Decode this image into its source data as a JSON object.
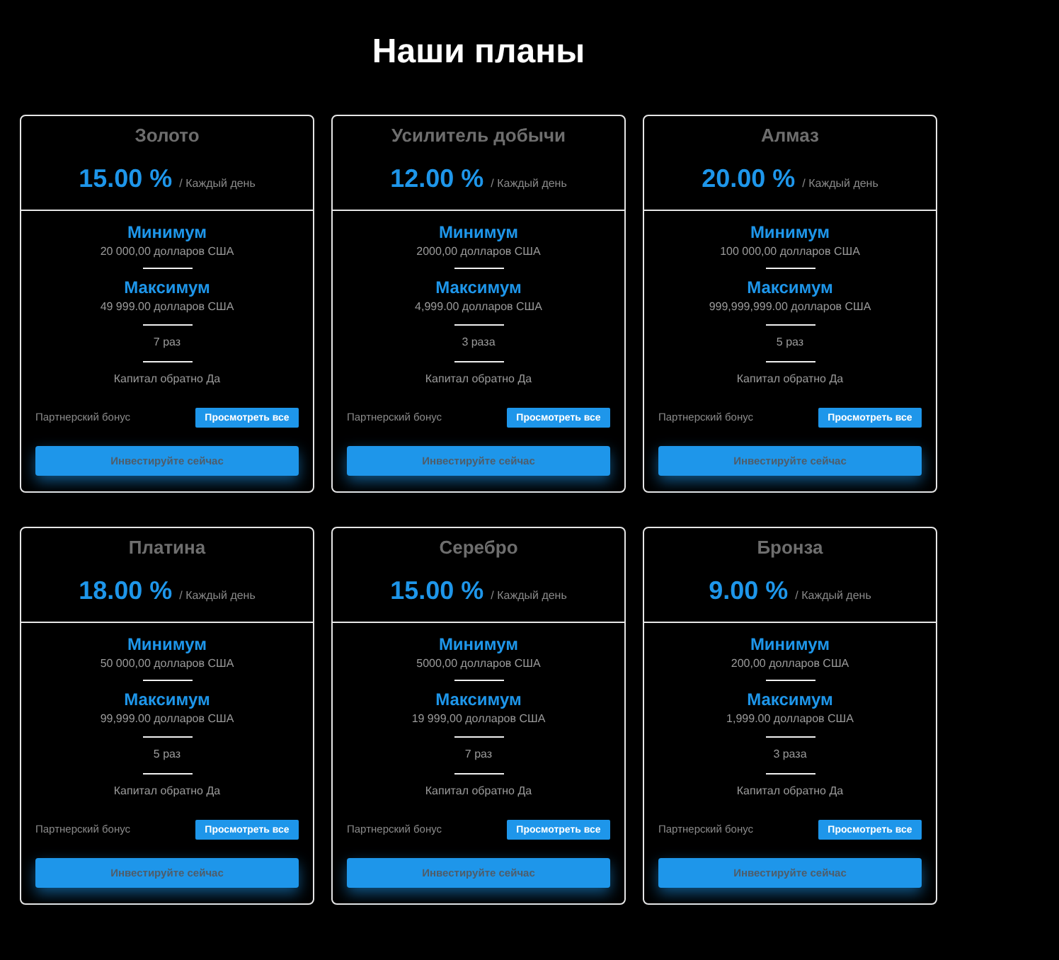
{
  "page": {
    "title": "Наши планы"
  },
  "plans": [
    {
      "name": "Золото",
      "rate": "15.00 %",
      "period": "/ Каждый день",
      "minimum_label": "Минимум",
      "minimum": "20 000,00 долларов США",
      "maximum_label": "Максимум",
      "maximum": "49 999.00 долларов США",
      "payouts": "7 раз",
      "capital_back": "Капитал обратно Да",
      "bonus_label": "Партнерский бонус",
      "bonus_button": "Просмотреть все",
      "invest_button": "Инвестируйте сейчас"
    },
    {
      "name": "Усилитель добычи",
      "rate": "12.00 %",
      "period": "/ Каждый день",
      "minimum_label": "Минимум",
      "minimum": "2000,00 долларов США",
      "maximum_label": "Максимум",
      "maximum": "4,999.00 долларов США",
      "payouts": "3 раза",
      "capital_back": "Капитал обратно Да",
      "bonus_label": "Партнерский бонус",
      "bonus_button": "Просмотреть все",
      "invest_button": "Инвестируйте сейчас"
    },
    {
      "name": "Алмаз",
      "rate": "20.00 %",
      "period": "/ Каждый день",
      "minimum_label": "Минимум",
      "minimum": "100 000,00 долларов США",
      "maximum_label": "Максимум",
      "maximum": "999,999,999.00 долларов США",
      "payouts": "5 раз",
      "capital_back": "Капитал обратно Да",
      "bonus_label": "Партнерский бонус",
      "bonus_button": "Просмотреть все",
      "invest_button": "Инвестируйте сейчас"
    },
    {
      "name": "Платина",
      "rate": "18.00 %",
      "period": "/ Каждый день",
      "minimum_label": "Минимум",
      "minimum": "50 000,00 долларов США",
      "maximum_label": "Максимум",
      "maximum": "99,999.00 долларов США",
      "payouts": "5 раз",
      "capital_back": "Капитал обратно Да",
      "bonus_label": "Партнерский бонус",
      "bonus_button": "Просмотреть все",
      "invest_button": "Инвестируйте сейчас"
    },
    {
      "name": "Серебро",
      "rate": "15.00 %",
      "period": "/ Каждый день",
      "minimum_label": "Минимум",
      "minimum": "5000,00 долларов США",
      "maximum_label": "Максимум",
      "maximum": "19 999,00 долларов США",
      "payouts": "7 раз",
      "capital_back": "Капитал обратно Да",
      "bonus_label": "Партнерский бонус",
      "bonus_button": "Просмотреть все",
      "invest_button": "Инвестируйте сейчас"
    },
    {
      "name": "Бронза",
      "rate": "9.00 %",
      "period": "/ Каждый день",
      "minimum_label": "Минимум",
      "minimum": "200,00 долларов США",
      "maximum_label": "Максимум",
      "maximum": "1,999.00 долларов США",
      "payouts": "3 раза",
      "capital_back": "Капитал обратно Да",
      "bonus_label": "Партнерский бонус",
      "bonus_button": "Просмотреть все",
      "invest_button": "Инвестируйте сейчас"
    }
  ]
}
